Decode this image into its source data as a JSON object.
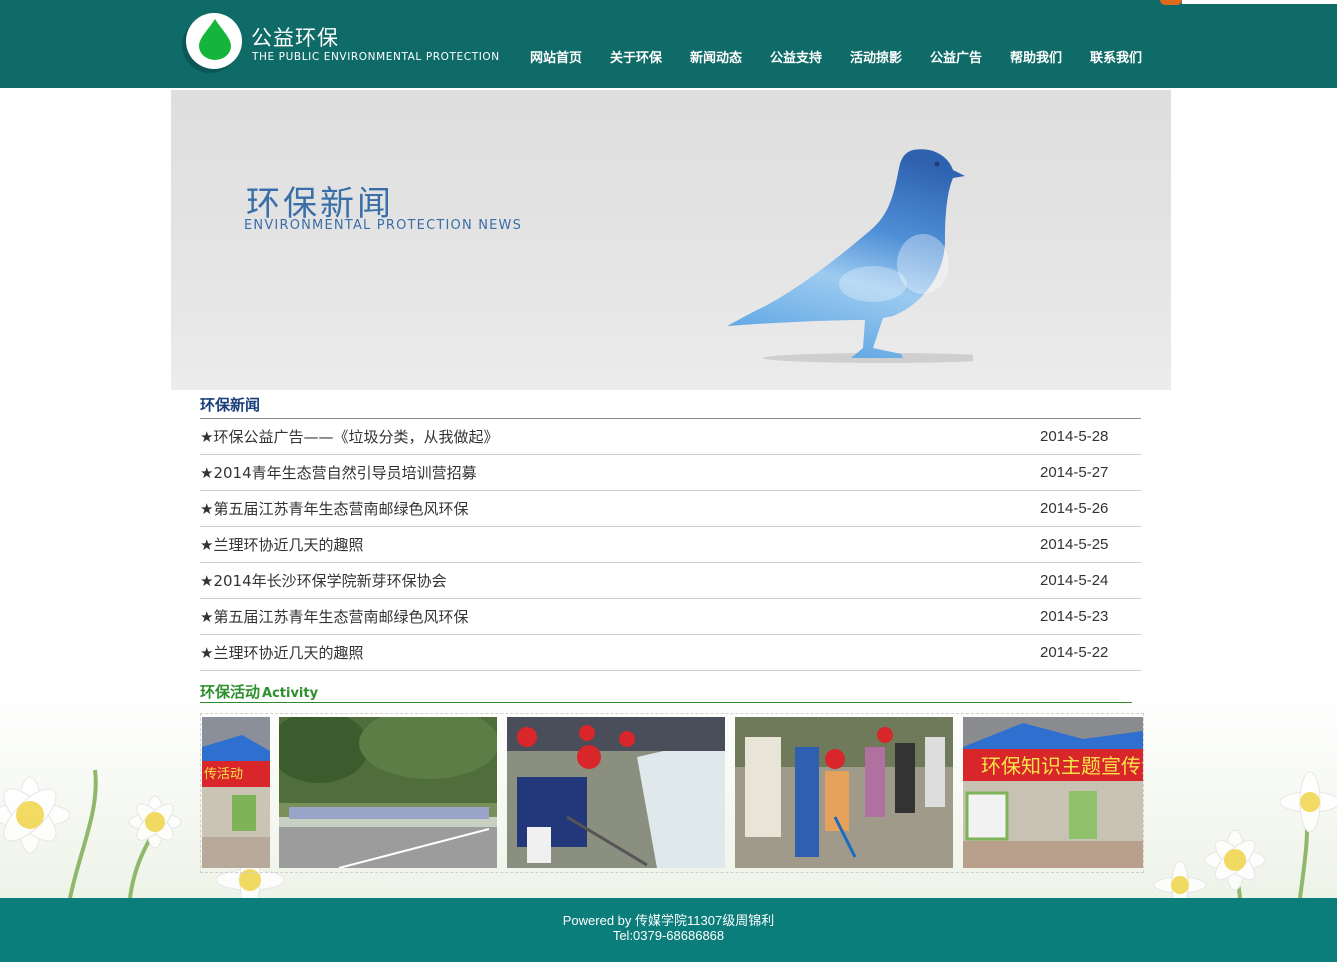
{
  "header": {
    "logo_title": "公益环保",
    "logo_subtitle": "THE PUBLIC ENVIRONMENTAL PROTECTION",
    "nav": [
      "网站首页",
      "关于环保",
      "新闻动态",
      "公益支持",
      "活动掠影",
      "公益广告",
      "帮助我们",
      "联系我们"
    ],
    "brand_color": "#0f6b68"
  },
  "banner": {
    "title": "环保新闻",
    "subtitle": "ENVIRONMENTAL PROTECTION NEWS",
    "accent_color": "#3a6ea8"
  },
  "news": {
    "heading": "环保新闻",
    "items": [
      {
        "title": "★环保公益广告——《垃圾分类，从我做起》",
        "date": "2014-5-28"
      },
      {
        "title": "★2014青年生态营自然引导员培训营招募",
        "date": "2014-5-27"
      },
      {
        "title": "★第五届江苏青年生态营南邮绿色风环保",
        "date": "2014-5-26"
      },
      {
        "title": "★兰理环协近几天的趣照",
        "date": "2014-5-25"
      },
      {
        "title": "★2014年长沙环保学院新芽环保协会",
        "date": "2014-5-24"
      },
      {
        "title": "★第五届江苏青年生态营南邮绿色风环保",
        "date": "2014-5-23"
      },
      {
        "title": "★兰理环协近几天的趣照",
        "date": "2014-5-22"
      }
    ]
  },
  "activity": {
    "heading": "环保活动",
    "heading_en": "Activity",
    "accent_color": "#2d8f2d",
    "photo_banner_text": "环保知识主题宣传活",
    "photo_banner_text_partial": "传活动"
  },
  "footer": {
    "powered": "Powered by 传媒学院11307级周锦利",
    "tel": "Tel:0379-68686868",
    "color": "#0b7d7b"
  }
}
